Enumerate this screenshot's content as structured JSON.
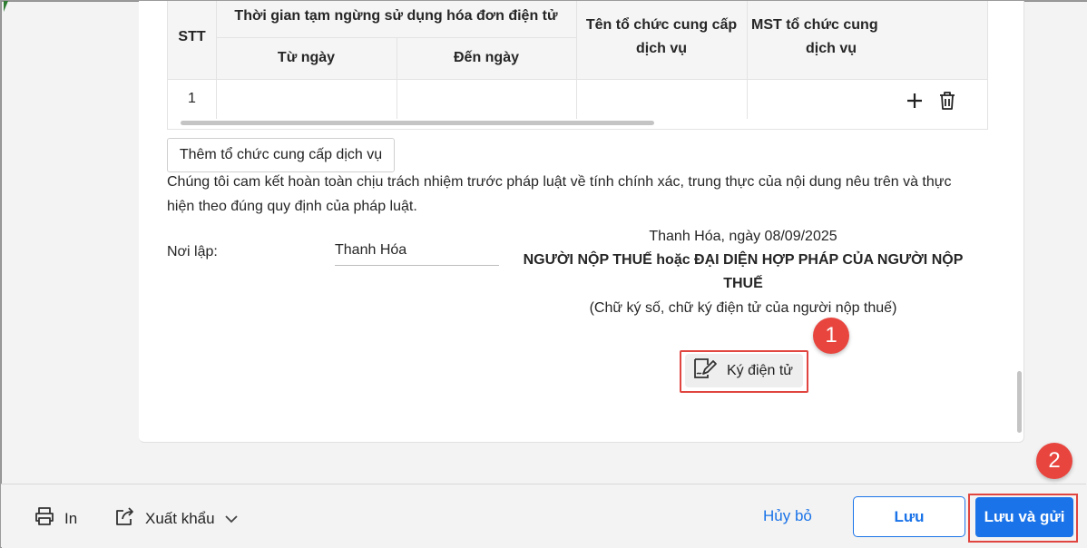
{
  "table": {
    "col_stt": "STT",
    "col_period": "Thời gian tạm ngừng sử dụng hóa đơn điện tử",
    "col_from": "Từ ngày",
    "col_to": "Đến ngày",
    "col_org_name_l1": "Tên tổ chức cung cấp",
    "col_org_name_l2": "dịch vụ",
    "col_org_tax_l1": "MST tổ chức cung",
    "col_org_tax_l2": "dịch vụ",
    "rows": [
      {
        "stt": "1",
        "from": "",
        "to": "",
        "org_name": "",
        "org_tax": ""
      }
    ],
    "add_icon": "plus-icon",
    "delete_icon": "trash-icon"
  },
  "add_org_button": "Thêm tổ chức cung cấp dịch vụ",
  "commitment_line1": "Chúng tôi cam kết hoàn toàn chịu trách nhiệm trước pháp luật về tính chính xác, trung thực của nội dung nêu trên và thực",
  "commitment_line2": "hiện theo đúng quy định của pháp luật.",
  "place": {
    "label": "Nơi lập:",
    "value": "Thanh Hóa"
  },
  "signature": {
    "date_line": "Thanh Hóa, ngày 08/09/2025",
    "title_l1": "NGƯỜI NỘP THUẾ hoặc ĐẠI DIỆN HỢP PHÁP CỦA NGƯỜI NỘP",
    "title_l2": "THUẾ",
    "subtitle": "(Chữ ký số, chữ ký điện tử của người nộp thuế)",
    "sign_button": "Ký điện tử",
    "sign_icon": "document-signature-icon"
  },
  "markers": {
    "m1": "1",
    "m2": "2",
    "color": "#e8453f"
  },
  "footer": {
    "print_label": "In",
    "export_label": "Xuất khẩu",
    "cancel_label": "Hủy bỏ",
    "save_label": "Lưu",
    "save_send_label": "Lưu và gửi",
    "accent": "#1a73e8"
  }
}
